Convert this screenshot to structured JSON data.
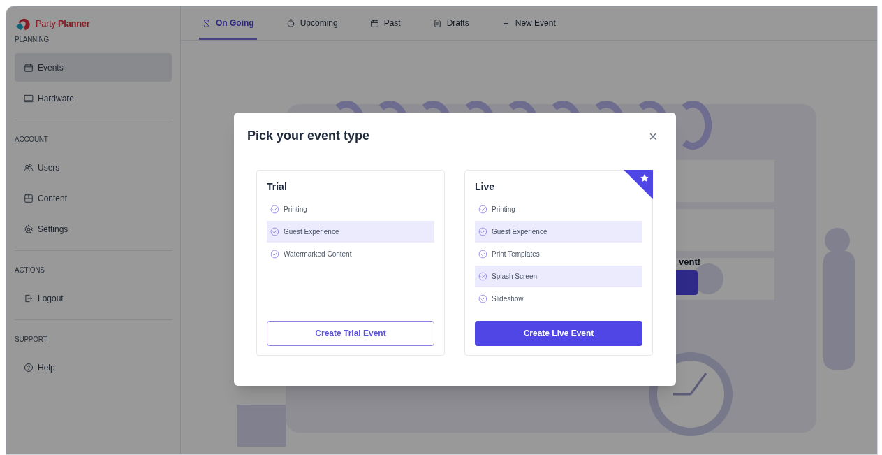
{
  "sidebar": {
    "logo_text": "Party **Planner**",
    "sections": [
      {
        "heading": "PLANNING",
        "items": [
          {
            "label": "Events",
            "selected": true
          },
          {
            "label": "Hardware",
            "selected": false
          }
        ]
      },
      {
        "heading": "ACCOUNT",
        "items": [
          {
            "label": "Users",
            "selected": false
          },
          {
            "label": "Content",
            "selected": false
          },
          {
            "label": "Settings",
            "selected": false
          }
        ]
      },
      {
        "heading": "ACTIONS",
        "items": [
          {
            "label": "Logout",
            "selected": false
          }
        ]
      },
      {
        "heading": "SUPPORT",
        "items": [
          {
            "label": "Help",
            "selected": false
          }
        ]
      }
    ]
  },
  "tabs": [
    {
      "label": "On Going",
      "selected": true
    },
    {
      "label": "Upcoming",
      "selected": false
    },
    {
      "label": "Past",
      "selected": false
    },
    {
      "label": "Drafts",
      "selected": false
    },
    {
      "label": "New Event",
      "selected": false
    }
  ],
  "background": {
    "message_fragment": "vent!"
  },
  "modal": {
    "title": "Pick your event type",
    "close": "×",
    "plans": [
      {
        "name": "Trial",
        "featured": false,
        "features": [
          "Printing",
          "Guest Experience",
          "Watermarked Content"
        ],
        "button": {
          "label": "Create Trial Event",
          "primary": false
        }
      },
      {
        "name": "Live",
        "featured": true,
        "features": [
          "Printing",
          "Guest Experience",
          "Print Templates",
          "Splash Screen",
          "Slideshow"
        ],
        "button": {
          "label": "Create Live Event",
          "primary": true
        }
      }
    ]
  }
}
